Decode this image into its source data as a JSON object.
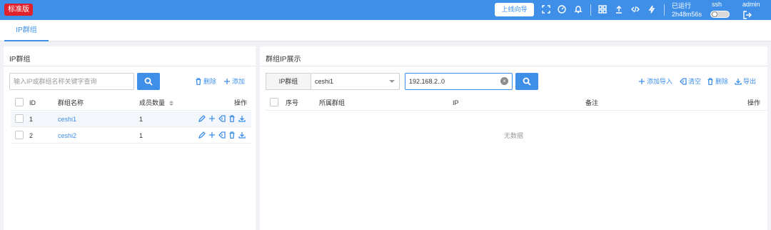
{
  "header": {
    "edition_badge": "标准版",
    "guide_button": "上线向导",
    "icons": [
      "fullscreen-icon",
      "dashboard-icon",
      "bell-icon",
      "apps-icon",
      "upload-icon",
      "code-icon",
      "flash-icon"
    ],
    "run_label": "已运行",
    "run_time": "2h48m56s",
    "ssh_label": "ssh",
    "ssh_enabled": false,
    "user": "admin",
    "logout_icon": "logout-icon"
  },
  "tabs": [
    {
      "label": "IP群组",
      "active": true
    }
  ],
  "left_panel": {
    "title": "IP群组",
    "search_placeholder": "输入IP或群组名称关键字查询",
    "delete_label": "删除",
    "add_label": "添加",
    "columns": {
      "id": "ID",
      "name": "群组名称",
      "members": "成员数量",
      "actions": "操作"
    },
    "rows": [
      {
        "id": "1",
        "name": "ceshi1",
        "members": "1"
      },
      {
        "id": "2",
        "name": "ceshi2",
        "members": "1"
      }
    ]
  },
  "right_panel": {
    "title": "群组IP展示",
    "group_label": "IP群组",
    "group_selected": "ceshi1",
    "ip_value": "192.168.2..0",
    "actions": {
      "import": "添加导入",
      "clear": "清空",
      "delete": "删除",
      "export": "导出"
    },
    "columns": {
      "seq": "序号",
      "group": "所属群组",
      "ip": "IP",
      "note": "备注",
      "actions": "操作"
    },
    "empty_text": "无数据"
  },
  "colors": {
    "primary": "#3f8fe8",
    "badge": "#e0202a"
  }
}
